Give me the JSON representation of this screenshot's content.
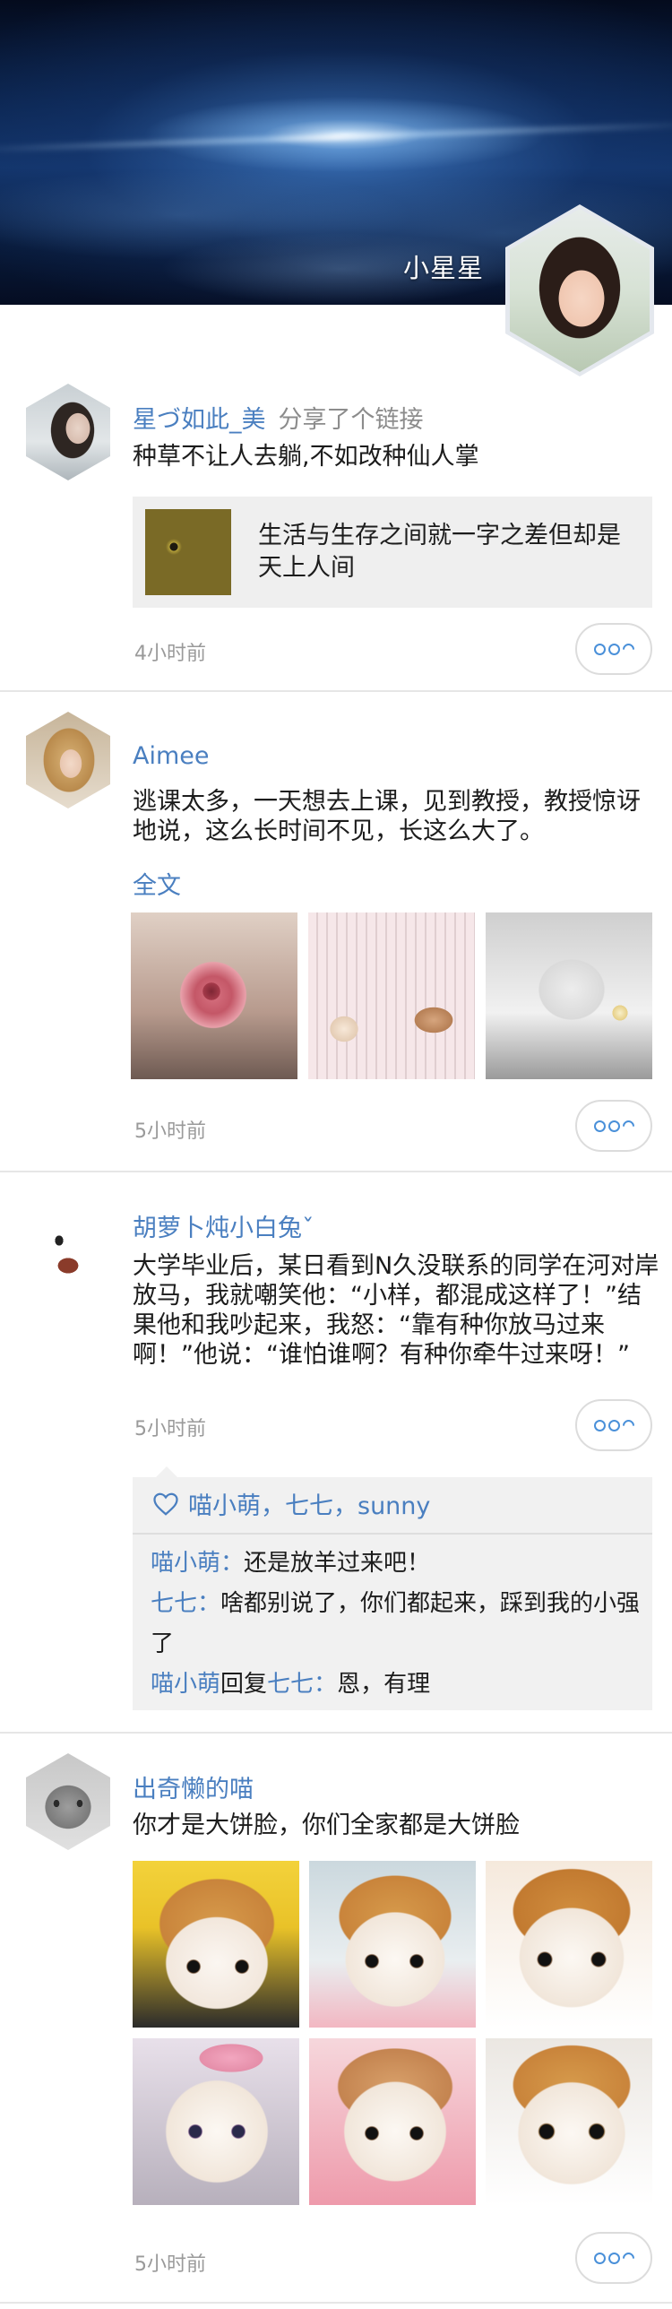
{
  "profile": {
    "name": "小星星"
  },
  "posts": [
    {
      "author": "星づ如此_美",
      "action": "分享了个链接",
      "text": "种草不让人去躺,不如改种仙人掌",
      "link": {
        "title": "生活与生存之间就一字之差但却是天上人间"
      },
      "time": "4小时前"
    },
    {
      "author": "Aimee",
      "text": "逃课太多，一天想去上课，见到教授，教授惊讶地说，这么长时间不见，长这么大了。",
      "read_more": "全文",
      "time": "5小时前"
    },
    {
      "author": "胡萝卜炖小白兔ˇ",
      "text": "大学毕业后，某日看到N久没联系的同学在河对岸放马，我就嘲笑他：“小样，都混成这样了！”结果他和我吵起来，我怒：“靠有种你放马过来啊！”他说：“谁怕谁啊？有种你牵牛过来呀！”",
      "time": "5小时前",
      "likes": "喵小萌，七七，sunny",
      "comments": [
        {
          "from": "喵小萌",
          "sep": "：",
          "text": "还是放羊过来吧！"
        },
        {
          "from": "七七",
          "sep": "：",
          "text": "啥都别说了，你们都起来，踩到我的小强了"
        },
        {
          "from": "喵小萌",
          "reply_word": "回复",
          "to": "七七",
          "sep": "：",
          "text": "恩，有理"
        }
      ]
    },
    {
      "author": "出奇懒的喵",
      "text": "你才是大饼脸，你们全家都是大饼脸",
      "time": "5小时前"
    }
  ]
}
